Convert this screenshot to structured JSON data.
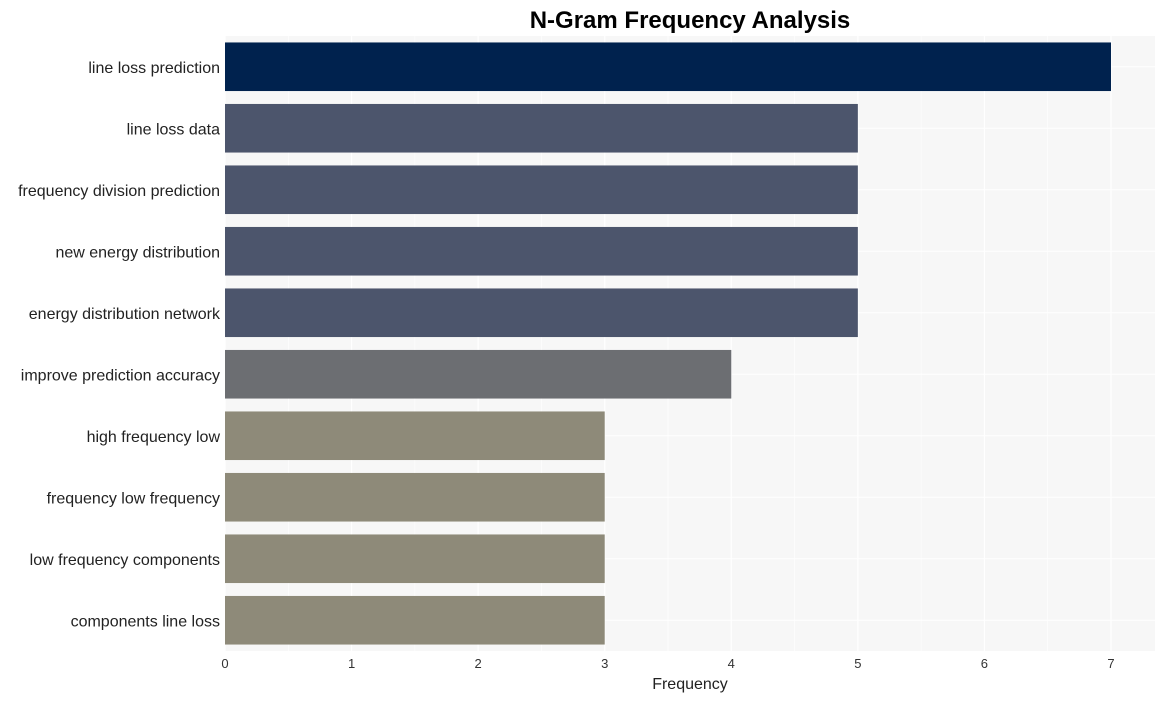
{
  "chart_data": {
    "type": "bar",
    "orientation": "horizontal",
    "title": "N-Gram Frequency Analysis",
    "xlabel": "Frequency",
    "ylabel": "",
    "xlim": [
      0,
      7.35
    ],
    "xticks": [
      0,
      1,
      2,
      3,
      4,
      5,
      6,
      7
    ],
    "grid": true,
    "categories": [
      "line loss prediction",
      "line loss data",
      "frequency division prediction",
      "new energy distribution",
      "energy distribution network",
      "improve prediction accuracy",
      "high frequency low",
      "frequency low frequency",
      "low frequency components",
      "components line loss"
    ],
    "values": [
      7,
      5,
      5,
      5,
      5,
      4,
      3,
      3,
      3,
      3
    ],
    "colors": [
      "#00224e",
      "#4c556c",
      "#4c556c",
      "#4c556c",
      "#4c556c",
      "#6c6e72",
      "#8e8a79",
      "#8e8a79",
      "#8e8a79",
      "#8e8a79"
    ],
    "background": "#f7f7f7",
    "gridColor": "#ffffff"
  }
}
